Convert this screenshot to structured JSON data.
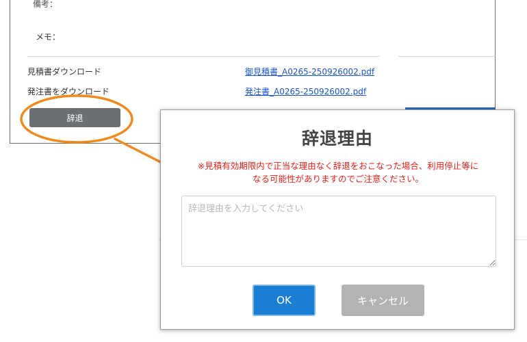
{
  "background": {
    "top_label": "備考：",
    "memo_label": "メモ：",
    "quote_download_label": "見積書ダウンロード",
    "quote_file": "御見積書_A0265-250926002.pdf",
    "order_download_label": "発注書をダウンロード",
    "order_file": "発注書_A0265-250926002.pdf",
    "decline_button": "辞退"
  },
  "modal": {
    "title": "辞退理由",
    "warning_line1": "※見積有効期限内で正当な理由なく辞退をおこなった場合、利用停止等に",
    "warning_line2": "なる可能性がありますのでご注意ください。",
    "reason_placeholder": "辞退理由を入力してください",
    "ok_button": "OK",
    "cancel_button": "キャンセル"
  },
  "colors": {
    "annotation": "#ef8a1e",
    "warning": "#e2231a",
    "ok": "#1a7fd4",
    "cancel": "#b3b3b3",
    "link": "#1a55c8"
  }
}
